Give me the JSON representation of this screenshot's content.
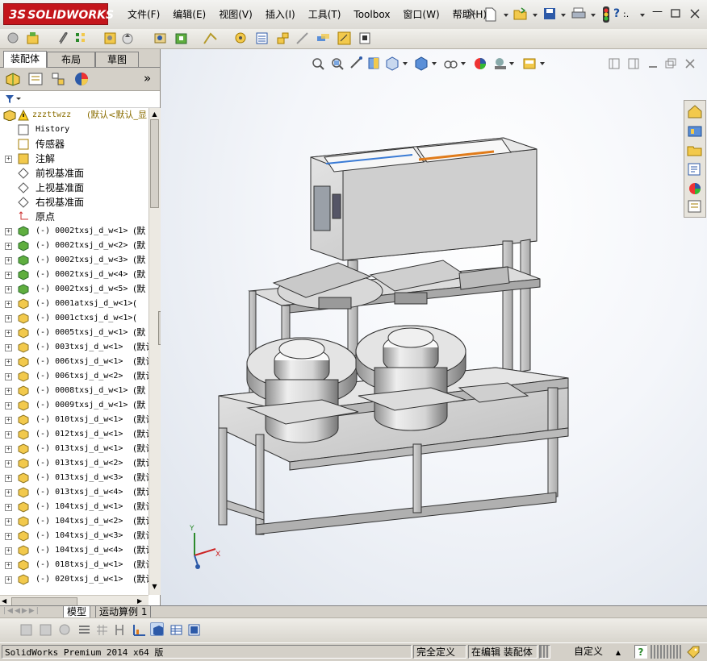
{
  "app": {
    "logo_text": "SOLIDWORKS",
    "logo_prefix": "3S",
    "brand_color": "#c4161c"
  },
  "menu": {
    "items": [
      "文件(F)",
      "编辑(E)",
      "视图(V)",
      "插入(I)",
      "工具(T)",
      "Toolbox",
      "窗口(W)",
      "帮助(H)"
    ],
    "search_hint": ":."
  },
  "panel": {
    "tabs": [
      "装配体",
      "布局",
      "草图"
    ],
    "active_tab": "装配体",
    "more_label": "»"
  },
  "tree": {
    "root": {
      "label": "zzzttwzz",
      "config": "(默认<默认_显"
    },
    "items": [
      {
        "label": "History",
        "icon": "history-icon",
        "expand": false
      },
      {
        "label": "传感器",
        "icon": "sensor-icon",
        "expand": false
      },
      {
        "label": "注解",
        "icon": "annotation-icon",
        "expand": true
      },
      {
        "label": "前视基准面",
        "icon": "plane-icon",
        "expand": false
      },
      {
        "label": "上视基准面",
        "icon": "plane-icon",
        "expand": false
      },
      {
        "label": "右视基准面",
        "icon": "plane-icon",
        "expand": false
      },
      {
        "label": "原点",
        "icon": "origin-icon",
        "expand": false
      },
      {
        "label": "(-) 0002txsj_d_w<1>",
        "suffix": "(默",
        "icon": "subassembly-icon",
        "expand": true
      },
      {
        "label": "(-) 0002txsj_d_w<2>",
        "suffix": "(默",
        "icon": "subassembly-icon",
        "expand": true
      },
      {
        "label": "(-) 0002txsj_d_w<3>",
        "suffix": "(默",
        "icon": "subassembly-icon",
        "expand": true
      },
      {
        "label": "(-) 0002txsj_d_w<4>",
        "suffix": "(默",
        "icon": "subassembly-icon",
        "expand": true
      },
      {
        "label": "(-) 0002txsj_d_w<5>",
        "suffix": "(默",
        "icon": "subassembly-icon",
        "expand": true
      },
      {
        "label": "(-) 0001atxsj_d_w<1>",
        "suffix": "(",
        "icon": "part-icon",
        "expand": true
      },
      {
        "label": "(-) 0001ctxsj_d_w<1>",
        "suffix": "(",
        "icon": "part-icon",
        "expand": true
      },
      {
        "label": "(-) 0005txsj_d_w<1>",
        "suffix": "(默",
        "icon": "part-icon",
        "expand": true
      },
      {
        "label": "(-) 003txsj_d_w<1>",
        "suffix": "(默认",
        "icon": "part-icon",
        "expand": true
      },
      {
        "label": "(-) 006txsj_d_w<1>",
        "suffix": "(默认",
        "icon": "part-icon",
        "expand": true
      },
      {
        "label": "(-) 006txsj_d_w<2>",
        "suffix": "(默认",
        "icon": "part-icon",
        "expand": true
      },
      {
        "label": "(-) 0008txsj_d_w<1>",
        "suffix": "(默",
        "icon": "part-icon",
        "expand": true
      },
      {
        "label": "(-) 0009txsj_d_w<1>",
        "suffix": "(默",
        "icon": "part-icon",
        "expand": true
      },
      {
        "label": "(-) 010txsj_d_w<1>",
        "suffix": "(默认",
        "icon": "part-icon",
        "expand": true
      },
      {
        "label": "(-) 012txsj_d_w<1>",
        "suffix": "(默认",
        "icon": "part-icon",
        "expand": true
      },
      {
        "label": "(-) 013txsj_d_w<1>",
        "suffix": "(默认",
        "icon": "part-icon",
        "expand": true
      },
      {
        "label": "(-) 013txsj_d_w<2>",
        "suffix": "(默认",
        "icon": "part-icon",
        "expand": true
      },
      {
        "label": "(-) 013txsj_d_w<3>",
        "suffix": "(默认",
        "icon": "part-icon",
        "expand": true
      },
      {
        "label": "(-) 013txsj_d_w<4>",
        "suffix": "(默认",
        "icon": "part-icon",
        "expand": true
      },
      {
        "label": "(-) 104txsj_d_w<1>",
        "suffix": "(默认",
        "icon": "part-icon",
        "expand": true
      },
      {
        "label": "(-) 104txsj_d_w<2>",
        "suffix": "(默认",
        "icon": "part-icon",
        "expand": true
      },
      {
        "label": "(-) 104txsj_d_w<3>",
        "suffix": "(默认",
        "icon": "part-icon",
        "expand": true
      },
      {
        "label": "(-) 104txsj_d_w<4>",
        "suffix": "(默认",
        "icon": "part-icon",
        "expand": true
      },
      {
        "label": "(-) 018txsj_d_w<1>",
        "suffix": "(默认",
        "icon": "part-icon",
        "expand": true
      },
      {
        "label": "(-) 020txsj_d_w<1>",
        "suffix": "(默认",
        "icon": "part-icon",
        "expand": true
      }
    ]
  },
  "bottom_tabs": [
    "模型",
    "运动算例 1"
  ],
  "status": {
    "product": "SolidWorks Premium 2014 x64 版",
    "definition": "完全定义",
    "editing": "在编辑 装配体",
    "units": "自定义",
    "units_caret": "▲",
    "help": "?"
  },
  "triad": {
    "x": "X",
    "y": "Y"
  },
  "colors": {
    "accent_orange": "#e07b1a",
    "accent_blue": "#3a7bd5",
    "frame_gray": "#c9c9c9"
  }
}
